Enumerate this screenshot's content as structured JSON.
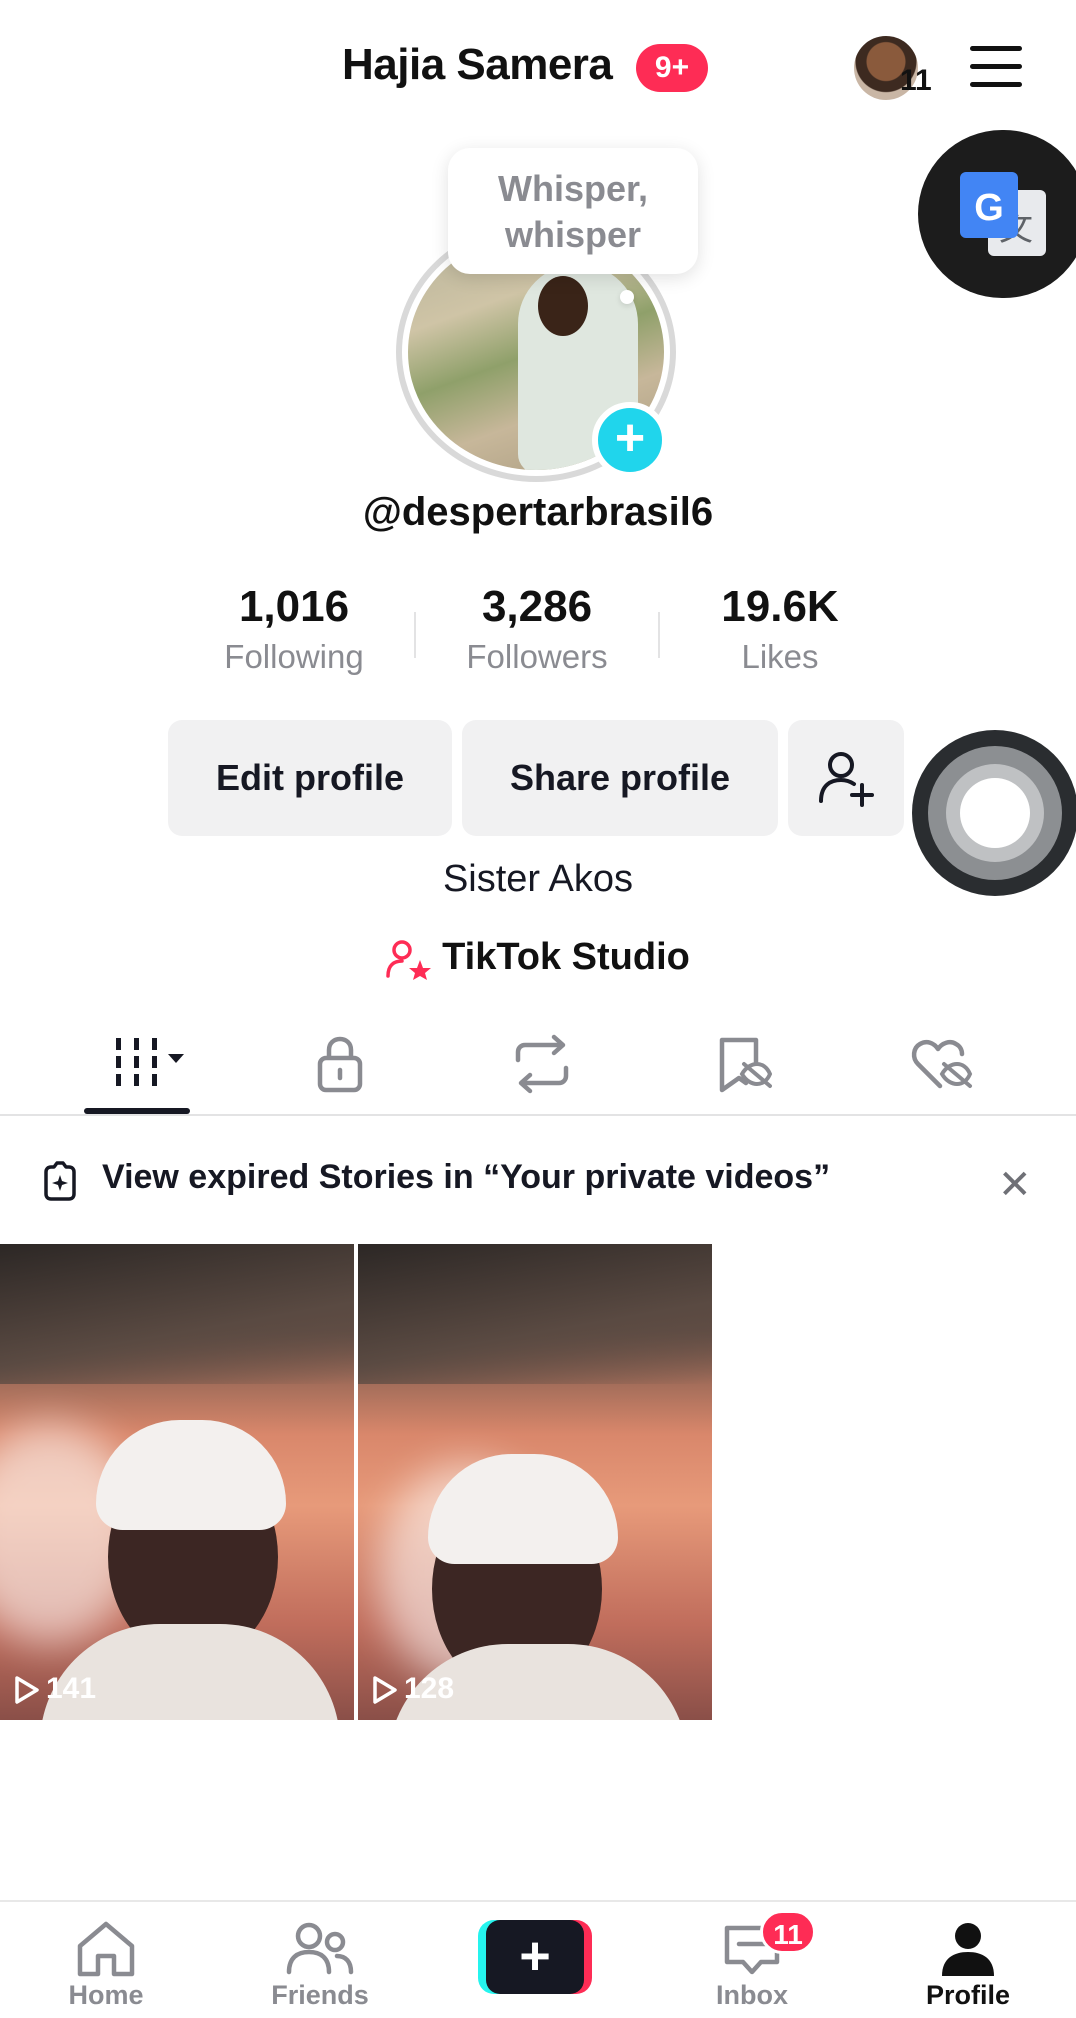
{
  "header": {
    "title": "Hajia Samera",
    "badge": "9+",
    "account_switch_count": "11"
  },
  "profile": {
    "status_note": [
      "Whisper,",
      "whisper"
    ],
    "username": "@despertarbrasil6",
    "bio": "Sister Akos",
    "studio_link": "TikTok Studio"
  },
  "stats": [
    {
      "value": "1,016",
      "label": "Following"
    },
    {
      "value": "3,286",
      "label": "Followers"
    },
    {
      "value": "19.6K",
      "label": "Likes"
    }
  ],
  "actions": {
    "edit_profile": "Edit profile",
    "share_profile": "Share profile"
  },
  "tabs": [
    {
      "icon": "videos-grid-icon",
      "active": true
    },
    {
      "icon": "lock-icon",
      "active": false
    },
    {
      "icon": "repost-icon",
      "active": false
    },
    {
      "icon": "bookmark-hidden-icon",
      "active": false
    },
    {
      "icon": "heart-hidden-icon",
      "active": false
    }
  ],
  "stories_banner": {
    "text": "View expired Stories in “Your private videos”"
  },
  "videos": [
    {
      "views": "141"
    },
    {
      "views": "128"
    }
  ],
  "bottom_nav": {
    "home": "Home",
    "friends": "Friends",
    "inbox": "Inbox",
    "inbox_badge": "11",
    "profile": "Profile"
  },
  "colors": {
    "accent_red": "#fe2c55",
    "accent_cyan": "#25f4ee",
    "add_button": "#20d5ec",
    "text_primary": "#161823",
    "text_secondary": "#8a8b91"
  }
}
